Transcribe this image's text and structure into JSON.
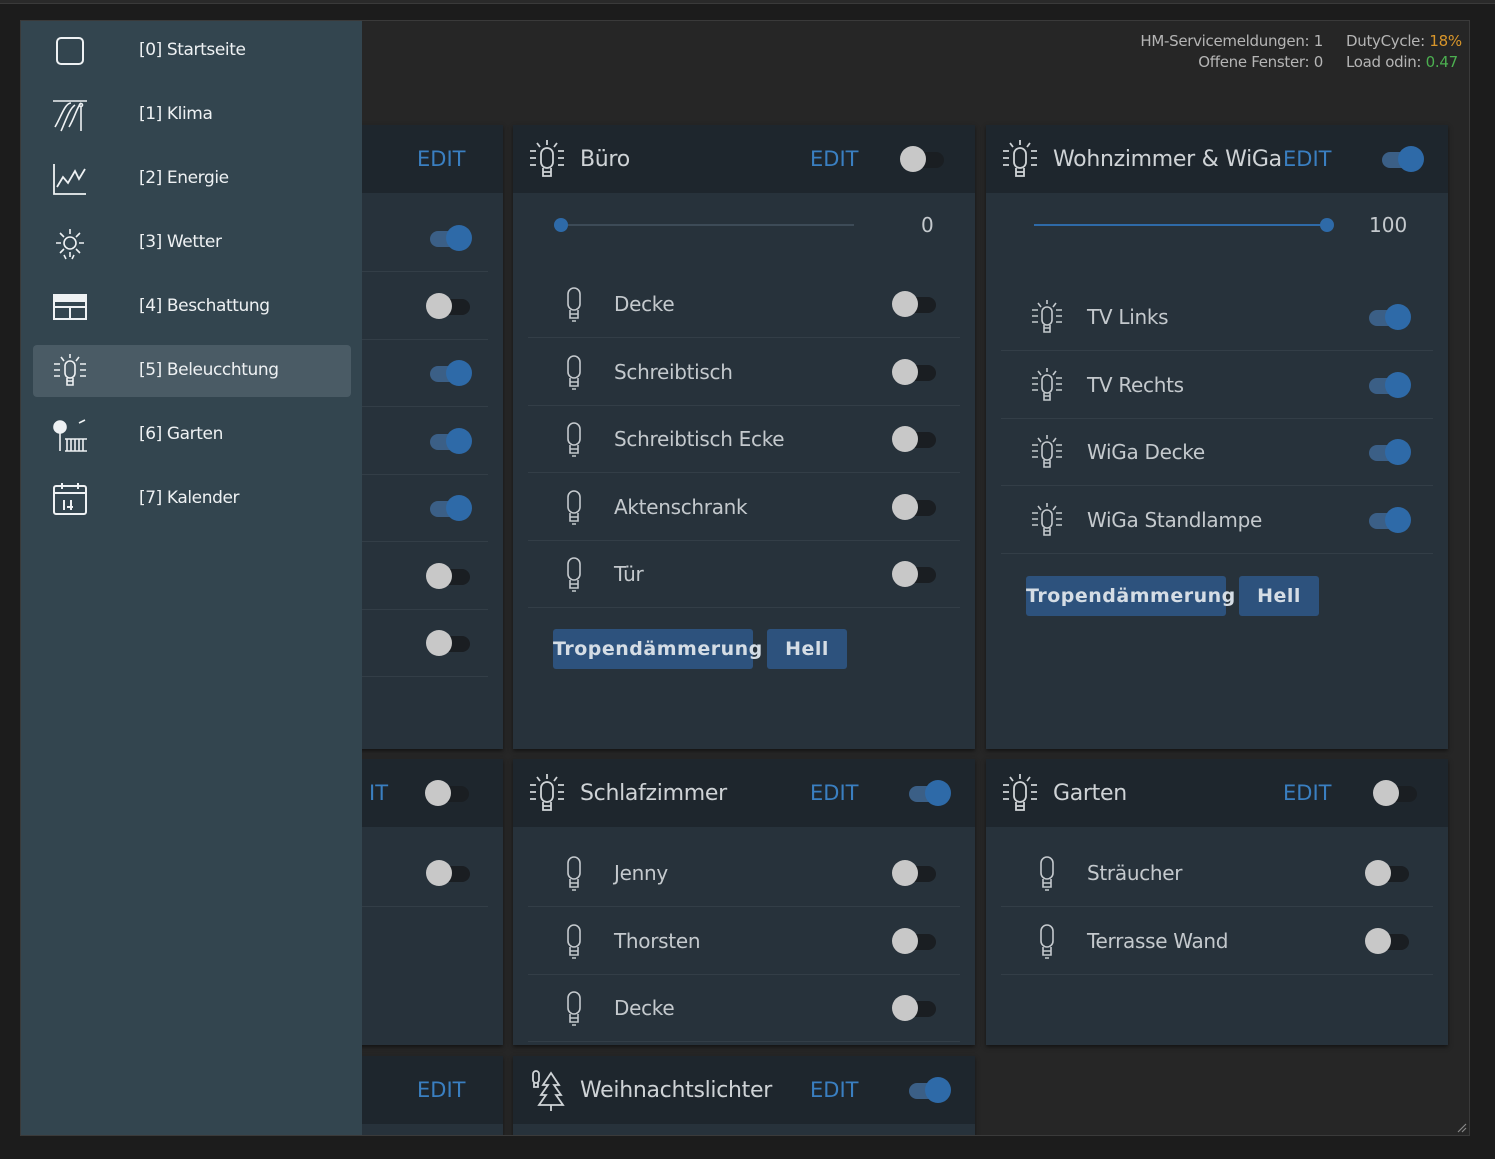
{
  "status": {
    "service_label": "HM-Servicemeldungen: 1",
    "windows_label": "Offene Fenster: 0",
    "duty_label": "DutyCycle: ",
    "duty_value": "18%",
    "load_label": "Load odin: ",
    "load_value": "0.47"
  },
  "sidebar": {
    "items": [
      {
        "label": "[0] Startseite",
        "icon": "square-icon"
      },
      {
        "label": "[1] Klima",
        "icon": "climate-icon"
      },
      {
        "label": "[2] Energie",
        "icon": "chart-icon"
      },
      {
        "label": "[3] Wetter",
        "icon": "sun-icon"
      },
      {
        "label": "[4] Beschattung",
        "icon": "shutter-icon"
      },
      {
        "label": "[5] Beleucchtung",
        "icon": "bulb-icon",
        "active": true
      },
      {
        "label": "[6] Garten",
        "icon": "garden-icon"
      },
      {
        "label": "[7] Kalender",
        "icon": "calendar-icon"
      }
    ]
  },
  "edit_label": "EDIT",
  "partial_edit_label": "IT",
  "buero": {
    "title": "Büro",
    "master_on": false,
    "level": "0",
    "level_fraction": 0,
    "rows": [
      {
        "label": "Decke",
        "on": false
      },
      {
        "label": "Schreibtisch",
        "on": false
      },
      {
        "label": "Schreibtisch Ecke",
        "on": false
      },
      {
        "label": "Aktenschrank",
        "on": false
      },
      {
        "label": "Tür",
        "on": false
      }
    ],
    "btn1": "Tropendämmerung",
    "btn2": "Hell"
  },
  "wohnzimmer": {
    "title": "Wohnzimmer & WiGa",
    "master_on": true,
    "level": "100",
    "level_fraction": 1,
    "rows": [
      {
        "label": "TV Links",
        "on": true
      },
      {
        "label": "TV Rechts",
        "on": true
      },
      {
        "label": "WiGa Decke",
        "on": true
      },
      {
        "label": "WiGa Standlampe",
        "on": true
      }
    ],
    "btn1": "Tropendämmerung",
    "btn2": "Hell"
  },
  "schlafzimmer": {
    "title": "Schlafzimmer",
    "master_on": true,
    "rows": [
      {
        "label": "Jenny",
        "on": false
      },
      {
        "label": "Thorsten",
        "on": false
      },
      {
        "label": "Decke",
        "on": false
      }
    ]
  },
  "garten": {
    "title": "Garten",
    "master_on": false,
    "rows": [
      {
        "label": "Sträucher",
        "on": false
      },
      {
        "label": "Terrasse Wand",
        "on": false
      }
    ]
  },
  "weihnacht": {
    "title": "Weihnachtslichter",
    "master_on": true
  },
  "left_card": {
    "toggles": [
      true,
      false,
      true,
      true,
      true,
      false,
      false
    ]
  },
  "left_card2": {
    "master_on": false,
    "toggles": [
      false
    ]
  }
}
